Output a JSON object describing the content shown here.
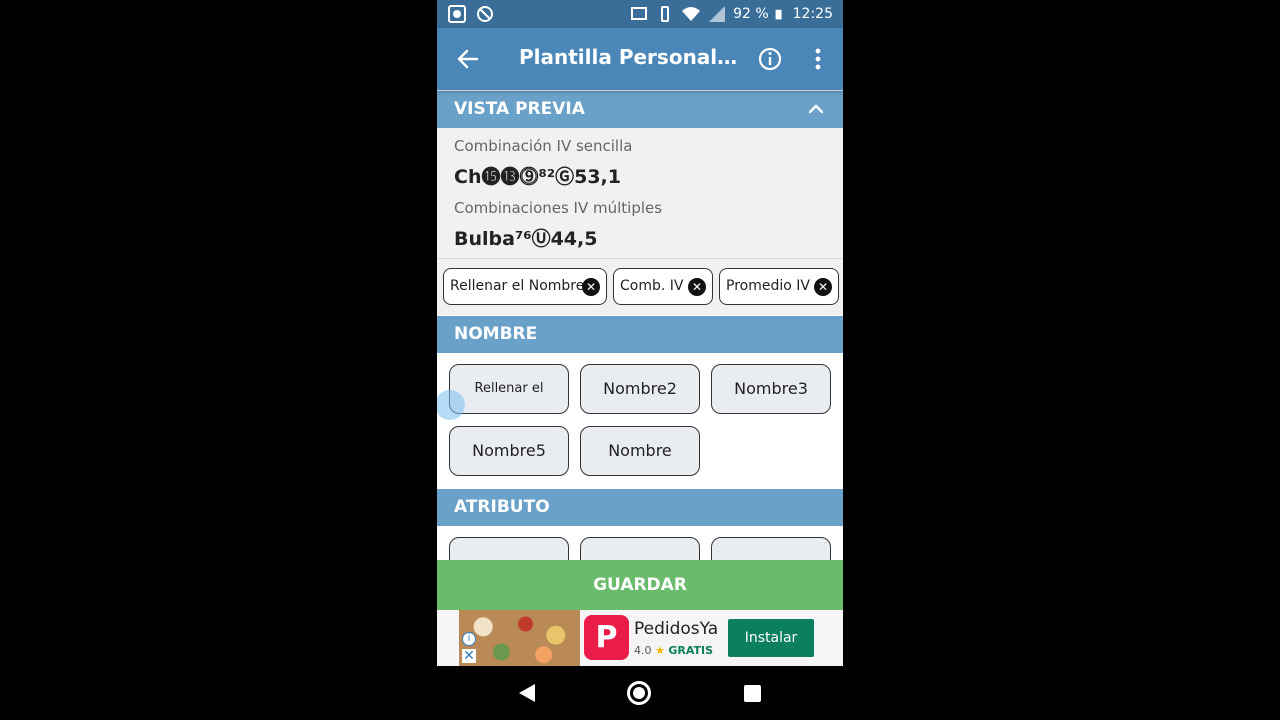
{
  "status_bar": {
    "battery": "92 %",
    "time": "12:25"
  },
  "app_bar": {
    "title": "Plantilla Personalizada"
  },
  "preview": {
    "header": "VISTA PREVIA",
    "single_label": "Combinación IV sencilla",
    "single_value": "Ch⓯⓭⓽⁸²Ⓖ53,1",
    "multi_label": "Combinaciones IV múltiples",
    "multi_value": "Bulba⁷⁶Ⓤ44,5"
  },
  "chips": [
    {
      "label": "Rellenar el Nombre"
    },
    {
      "label": "Comb. IV"
    },
    {
      "label": "Promedio IV"
    }
  ],
  "name_section": {
    "header": "NOMBRE",
    "buttons": [
      "Rellenar el Nombre",
      "Nombre2",
      "Nombre3",
      "Nombre5",
      "Nombre"
    ]
  },
  "attribute_section": {
    "header": "ATRIBUTO"
  },
  "save_label": "GUARDAR",
  "ad": {
    "app_name": "PedidosYa",
    "rating": "4.0",
    "free_label": "GRATIS",
    "install_label": "Instalar"
  },
  "colors": {
    "status_bar": "#3a6e98",
    "app_bar": "#4a86b8",
    "section_header": "#6aa1c9",
    "save": "#6bbb6d",
    "install": "#0b7f5e"
  }
}
